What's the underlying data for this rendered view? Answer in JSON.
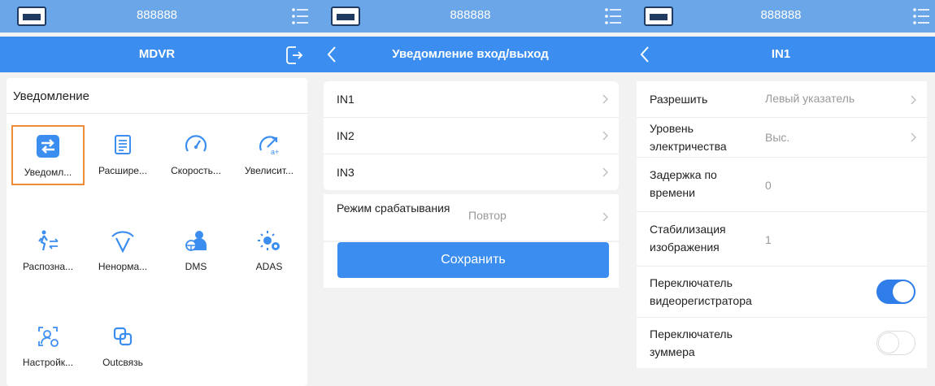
{
  "colors": {
    "status_bar": "#6aa6e8",
    "nav_bar": "#3b8ef0",
    "accent": "#2f7de8",
    "selected_border": "#ef8c3a",
    "icon_blue": "#3b8ef0"
  },
  "status": {
    "device_number": "888888"
  },
  "screen1": {
    "title": "MDVR",
    "section_title": "Уведомление",
    "tiles": [
      {
        "label": "Уведомл...",
        "icon": "switch-arrows-icon",
        "selected": true
      },
      {
        "label": "Расшире...",
        "icon": "document-list-icon",
        "selected": false
      },
      {
        "label": "Скорость...",
        "icon": "speedometer-icon",
        "selected": false
      },
      {
        "label": "Увелисит...",
        "icon": "acceleration-icon",
        "selected": false
      },
      {
        "label": "Распозна...",
        "icon": "pedestrian-icon",
        "selected": false
      },
      {
        "label": "Ненорма...",
        "icon": "abnormal-signal-icon",
        "selected": false
      },
      {
        "label": "DMS",
        "icon": "driver-icon",
        "selected": false
      },
      {
        "label": "ADAS",
        "icon": "adas-sensor-icon",
        "selected": false
      },
      {
        "label": "Настройк...",
        "icon": "face-settings-icon",
        "selected": false
      },
      {
        "label": "Outсвязь",
        "icon": "link-icon",
        "selected": false
      }
    ]
  },
  "screen2": {
    "title": "Уведомление вход/выход",
    "inputs": [
      "IN1",
      "IN2",
      "IN3"
    ],
    "trigger_mode": {
      "label": "Режим срабатывания",
      "value": "Повтор"
    },
    "save_label": "Сохранить"
  },
  "screen3": {
    "title": "IN1",
    "enable": {
      "label": "Разрешить",
      "value": "Левый указатель"
    },
    "level": {
      "label": "Уровень электричества",
      "value": "Выс."
    },
    "delay": {
      "label": "Задержка по времени",
      "value": "0"
    },
    "stabilization": {
      "label": "Стабилизация изображения",
      "value": "1"
    },
    "recorder_switch": {
      "label": "Переключатель видеорегистратора",
      "on": true
    },
    "buzzer_switch": {
      "label": "Переключатель зуммера",
      "on": false
    }
  }
}
